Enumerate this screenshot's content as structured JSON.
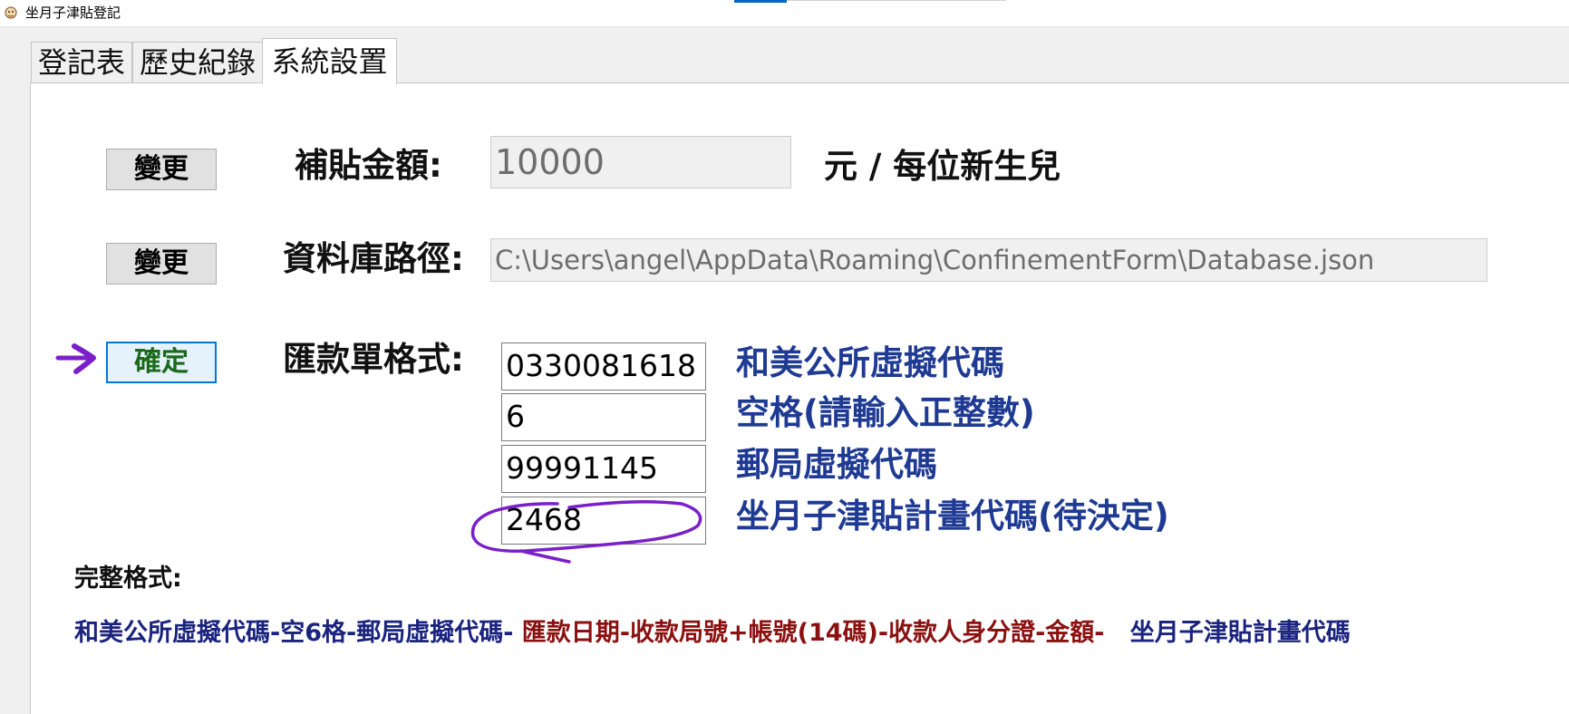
{
  "window": {
    "title": "坐月子津貼登記",
    "icon": "app-icon"
  },
  "tabs": [
    {
      "label": "登記表",
      "active": false
    },
    {
      "label": "歷史紀錄",
      "active": false
    },
    {
      "label": "系統設置",
      "active": true
    }
  ],
  "settings": {
    "subsidy": {
      "button_label": "變更",
      "label": "補貼金額:",
      "value": "10000",
      "unit": "元 / 每位新生兒"
    },
    "database": {
      "button_label": "變更",
      "label": "資料庫路徑:",
      "value": "C:\\Users\\angel\\AppData\\Roaming\\ConfinementForm\\Database.json"
    },
    "remittance": {
      "button_label": "確定",
      "label": "匯款單格式:",
      "fields": [
        {
          "value": "0330081618",
          "desc": "和美公所虛擬代碼"
        },
        {
          "value": "6",
          "desc": "空格(請輸入正整數)"
        },
        {
          "value": "99991145",
          "desc": "郵局虛擬代碼"
        },
        {
          "value": "2468",
          "desc": "坐月子津貼計畫代碼(待決定)"
        }
      ]
    }
  },
  "full_format": {
    "title": "完整格式:",
    "part1": "和美公所虛擬代碼-空6格-郵局虛擬代碼-",
    "part2": " 匯款日期-收款局號+帳號(14碼)-收款人身分證-金額-",
    "part3": "   坐月子津貼計畫代碼"
  },
  "colors": {
    "desc_blue": "#1f3a93",
    "format_blue": "#1a237e",
    "format_red": "#8b1010",
    "annotation_purple": "#7a1fc9",
    "focus_border": "#0078d7"
  }
}
